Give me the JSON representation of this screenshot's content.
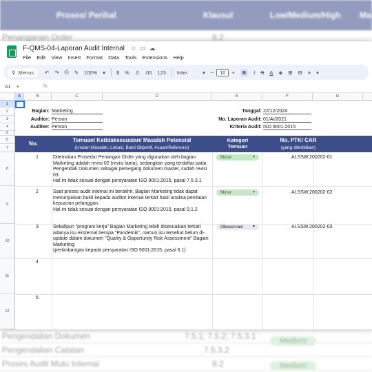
{
  "background": {
    "headers": [
      "Proses/ Perihal",
      "Klausul",
      "Low/Medium/High",
      "Ma"
    ],
    "rows": [
      {
        "process": "Penanganan Order",
        "clause": "8.2"
      },
      {
        "process": "Pengendalian Dokumen",
        "clause": "7.5.1; 7.5.2; 7.5.3.1",
        "level": "Medium"
      },
      {
        "process": "Pengendalian Catatan",
        "clause": "7.5.3.2"
      },
      {
        "process": "Proses Audit Mutu Internal",
        "clause": "9.2",
        "level": "Medium"
      }
    ]
  },
  "app": {
    "title": "F-QMS-04-Laporan Audit Internal",
    "title_icons": [
      "star-icon",
      "folder-icon",
      "cloud-icon"
    ],
    "menu": [
      "File",
      "Edit",
      "View",
      "Insert",
      "Format",
      "Data",
      "Tools",
      "Extensions",
      "Help"
    ]
  },
  "toolbar": {
    "search_label": "Menus",
    "zoom": "100%",
    "currency": "$",
    "percent": "%",
    "dec_less": ".0",
    "dec_more": ".00",
    "number_format": "123",
    "font": "Inter",
    "font_size": "10",
    "bold": "B",
    "italic": "I",
    "strike": "S",
    "text_color": "A"
  },
  "formula": {
    "cell_ref": "A1",
    "fx": "fx"
  },
  "columns": [
    "A",
    "B",
    "C",
    "D",
    "E",
    "F",
    "G"
  ],
  "rows": [
    "1",
    "2",
    "3",
    "4",
    "5",
    "6",
    "7",
    "8",
    "9",
    "10",
    "11",
    "12"
  ],
  "meta": {
    "bagian_label": "Bagian:",
    "bagian_value": "Marketing",
    "auditor_label": "Auditor:",
    "auditor_value": "Person",
    "auditee_label": "Auditee:",
    "auditee_value": "Person",
    "tanggal_label": "Tanggal:",
    "tanggal_value": "22/12/2024",
    "laporan_label": "No. Laporan Audit:",
    "laporan_value": "01/AI/2021",
    "kriteria_label": "Kriteria Audit:",
    "kriteria_value": "ISO 9001:2015"
  },
  "table_header": {
    "no": "No.",
    "temuan": "Temuan/ Ketidaksesuaian/ Masalah Potensial",
    "temuan_sub": "(Uraian Masalah, Lokasi, Bukti Objektif, Acuan/Referensi)",
    "kategori": "Kategori Temuan",
    "ptk": "No. PTK/ CAR",
    "ptk_sub": "(yang diterbitkan)"
  },
  "findings": [
    {
      "no": "1",
      "text": "Ditemukan Prosedur Penangan Order yang digunakan oleh bagian Marketing adalah revisi 02 (revisi lama), sedangkan yang terdaftar pada Pengendali Dokumen sebagai pemegang dokumen master, sudah revisi 03.\nHal ini tidak sesuai dengan persyaratan ISO 9001:2015, pasal 7.5.3.1",
      "category": "Minor",
      "car": "AI.SSW.200202-01"
    },
    {
      "no": "2",
      "text": "Saat proses audit internal ini berakhir, Bagian Marketing tidak dapat menunjukkan bukti kepada auditor internal terkait hasil analisa penilaian kepuasan pelanggan.\nHal ini tidak sesuai dengan persyaratan ISO 9001:2015, pasal 9.1.2",
      "category": "Minor",
      "car": "AI.SSW.200202-02"
    },
    {
      "no": "3",
      "text": "Sekalipun \"program kerja\" Bagian Marketing telah disesuaikan terkait adanya isu eksternal berupa \"Pandemik\", namun isu tersebut belum di-update dalam dokumen \"Quality & Opportunity Risk Assessment\" Bagian Marketing.\n(pertimbangan kepada persyaratan ISO 9001:2015, pasal 6.1)",
      "category": "Obeservasi",
      "car": "AI.SSW.200202-03"
    },
    {
      "no": "4",
      "text": "",
      "category": "",
      "car": ""
    },
    {
      "no": "5",
      "text": "",
      "category": "",
      "car": ""
    }
  ],
  "colors": {
    "header_band": "#3c4d8a",
    "minor_chip": "#c8e6c9",
    "obs_chip": "#e8eaed",
    "selection": "#1a73e8",
    "logo": "#0f9d58"
  }
}
